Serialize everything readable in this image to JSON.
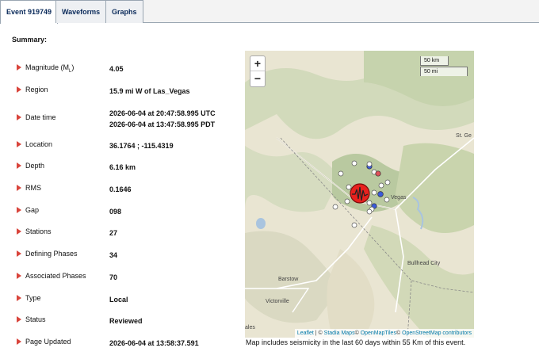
{
  "tabs": [
    {
      "label": "Event 919749"
    },
    {
      "label": "Waveforms"
    },
    {
      "label": "Graphs"
    }
  ],
  "summary": {
    "title": "Summary:",
    "magnitude": {
      "label": "Magnitude (M",
      "sub": "L",
      "suffix": ")",
      "value": "4.05"
    },
    "region": {
      "label": "Region",
      "value": "15.9 mi W of Las_Vegas"
    },
    "datetime": {
      "label": "Date time",
      "value_utc": "2026-06-04 at 20:47:58.995 UTC",
      "value_pdt": "2026-06-04 at 13:47:58.995 PDT"
    },
    "location": {
      "label": "Location",
      "value": "36.1764 ; -115.4319"
    },
    "depth": {
      "label": "Depth",
      "value": "6.16 km"
    },
    "rms": {
      "label": "RMS",
      "value": "0.1646"
    },
    "gap": {
      "label": "Gap",
      "value": "098"
    },
    "stations": {
      "label": "Stations",
      "value": "27"
    },
    "defining_phases": {
      "label": "Defining Phases",
      "value": "34"
    },
    "associated_phases": {
      "label": "Associated Phases",
      "value": "70"
    },
    "type": {
      "label": "Type",
      "value": "Local"
    },
    "status": {
      "label": "Status",
      "value": "Reviewed"
    },
    "page_updated": {
      "label": "Page Updated",
      "value": "2026-06-04 at 13:58:37.591"
    }
  },
  "map": {
    "zoom_in": "+",
    "zoom_out": "−",
    "scale_km": "50 km",
    "scale_mi": "50 mi",
    "places": {
      "vegas": "Vegas",
      "st_george": "St. Ge",
      "bullhead": "Bullhead City",
      "barstow": "Barstow",
      "victorville": "Victorville",
      "edge": "ales"
    },
    "attribution": {
      "leaflet": "Leaflet",
      "sep1": " | © ",
      "stadia": "Stadia Maps",
      "sep2": "© ",
      "openmaptiles": "OpenMapTiles",
      "sep3": "© ",
      "osm": "OpenStreetMap contributors"
    },
    "colors": {
      "event": "#e8211e",
      "station_white": "#ffffff",
      "station_blue": "#3b5bdb",
      "station_red": "#e0525a"
    }
  },
  "caption": "Map includes seismicity in the last 60 days within 55 Km of this event."
}
